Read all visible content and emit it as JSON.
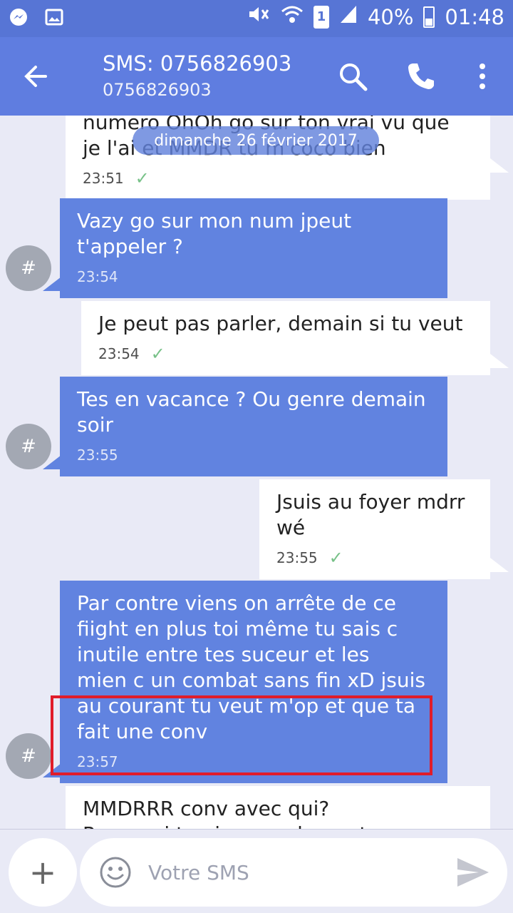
{
  "status_bar": {
    "left_icons": [
      "messenger-icon",
      "gallery-icon"
    ],
    "battery_percent": "40%",
    "time": "01:48",
    "sim_badge": "1"
  },
  "header": {
    "title": "SMS: 0756826903",
    "subtitle": "0756826903"
  },
  "thread": {
    "date_chip": "dimanche 26 février 2017",
    "messages": [
      {
        "direction": "out",
        "text": "numero OhOh go sur ton vrai vu que\nje l'ai et MMDR tu m'coco bien",
        "time": "23:51",
        "delivered": true
      },
      {
        "direction": "in",
        "text": "Vazy go sur mon num jpeut\nt'appeler ?",
        "time": "23:54",
        "avatar": "#"
      },
      {
        "direction": "out",
        "text": "Je peut pas parler, demain si tu veut",
        "time": "23:54",
        "delivered": true
      },
      {
        "direction": "in",
        "text": "Tes en vacance ? Ou genre demain\nsoir",
        "time": "23:55",
        "avatar": "#"
      },
      {
        "direction": "out",
        "text": "Jsuis au foyer mdrr\nwé",
        "time": "23:55",
        "delivered": true
      },
      {
        "direction": "in",
        "text": "Par contre viens on arrête de ce\nfiight en plus toi même tu sais c\ninutile entre tes suceur et les\nmien c un combat sans fin xD jsuis\nau courant tu veut m'op et que ta\nfait une conv",
        "time": "23:57",
        "avatar": "#"
      },
      {
        "direction": "out",
        "text": "MMDRRR conv avec qui?\nPourquoi tu viens seulement",
        "time": "",
        "delivered": false
      }
    ]
  },
  "composer": {
    "add_symbol": "+",
    "placeholder": "Votre SMS"
  },
  "colors": {
    "status_bar": "#5775d5",
    "app_bar": "#5f7de0",
    "incoming_bubble": "#6183e0",
    "outgoing_bubble": "#ffffff",
    "background": "#e9eaf6",
    "highlight": "#e01c2a",
    "check": "#56b26b"
  }
}
